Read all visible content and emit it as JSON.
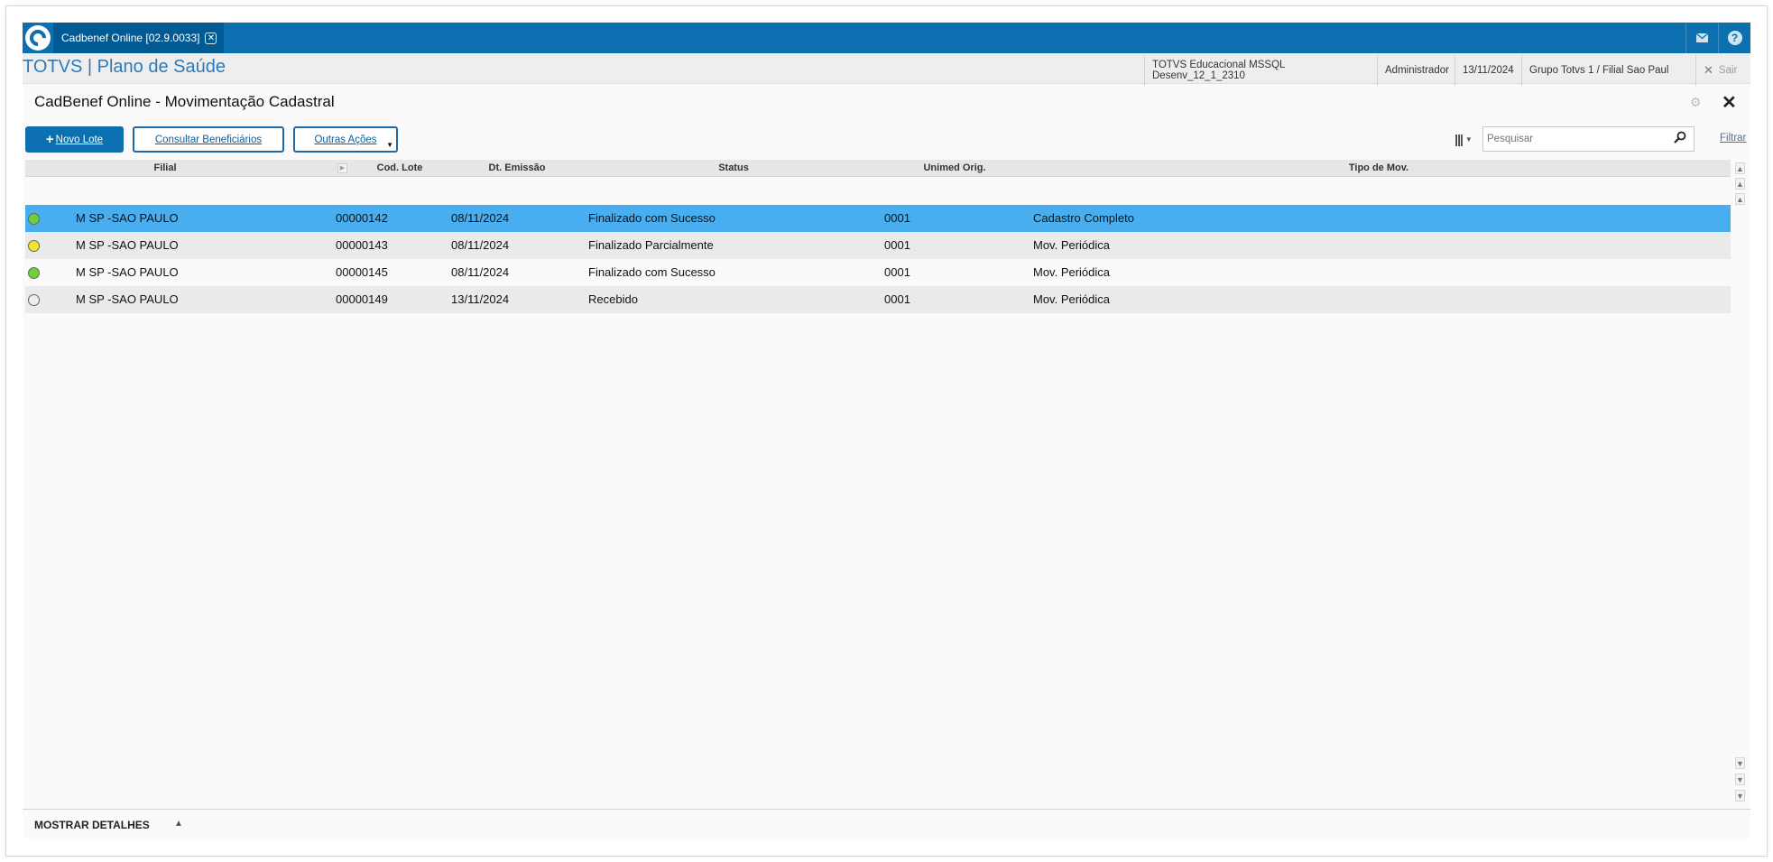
{
  "topbar": {
    "tab_label": "Cadbenef Online [02.9.0033]",
    "tab_close": "✕",
    "mail_icon": "mail-icon",
    "help_icon": "help-icon",
    "help_glyph": "?"
  },
  "inforow": {
    "brand": "TOTVS | Plano de Saúde",
    "environment": "TOTVS Educacional MSSQL Desenv_12_1_2310",
    "user": "Administrador",
    "date": "13/11/2024",
    "group": "Grupo Totvs 1 / Filial Sao Paul",
    "exit_label": "Sair"
  },
  "page": {
    "title": "CadBenef Online - Movimentação Cadastral"
  },
  "toolbar": {
    "new_batch_label": "Novo Lote",
    "consult_label": "Consultar Beneficiários",
    "more_actions_label": "Outras Ações",
    "search_placeholder": "Pesquisar",
    "filter_label": "Filtrar"
  },
  "grid": {
    "columns": [
      "Filial",
      "Cod. Lote",
      "Dt. Emissão",
      "Status",
      "Unimed Orig.",
      "Tipo de Mov."
    ],
    "rows": [
      {
        "status_color": "#6fcf3a",
        "filial": "M SP -SAO PAULO",
        "cod_lote": "00000142",
        "dt_emissao": "08/11/2024",
        "status": "Finalizado com Sucesso",
        "unimed_orig": "0001",
        "tipo_mov": "Cadastro Completo"
      },
      {
        "status_color": "#f2e531",
        "filial": "M SP -SAO PAULO",
        "cod_lote": "00000143",
        "dt_emissao": "08/11/2024",
        "status": "Finalizado Parcialmente",
        "unimed_orig": "0001",
        "tipo_mov": "Mov. Periódica"
      },
      {
        "status_color": "#6fcf3a",
        "filial": "M SP -SAO PAULO",
        "cod_lote": "00000145",
        "dt_emissao": "08/11/2024",
        "status": "Finalizado com Sucesso",
        "unimed_orig": "0001",
        "tipo_mov": "Mov. Periódica"
      },
      {
        "status_color": "#eeeeee",
        "filial": "M SP -SAO PAULO",
        "cod_lote": "00000149",
        "dt_emissao": "13/11/2024",
        "status": "Recebido",
        "unimed_orig": "0001",
        "tipo_mov": "Mov. Periódica"
      }
    ]
  },
  "details": {
    "label": "MOSTRAR DETALHES"
  },
  "colors": {
    "brand_blue": "#0c6fb0",
    "selected_row": "#48aef0"
  }
}
